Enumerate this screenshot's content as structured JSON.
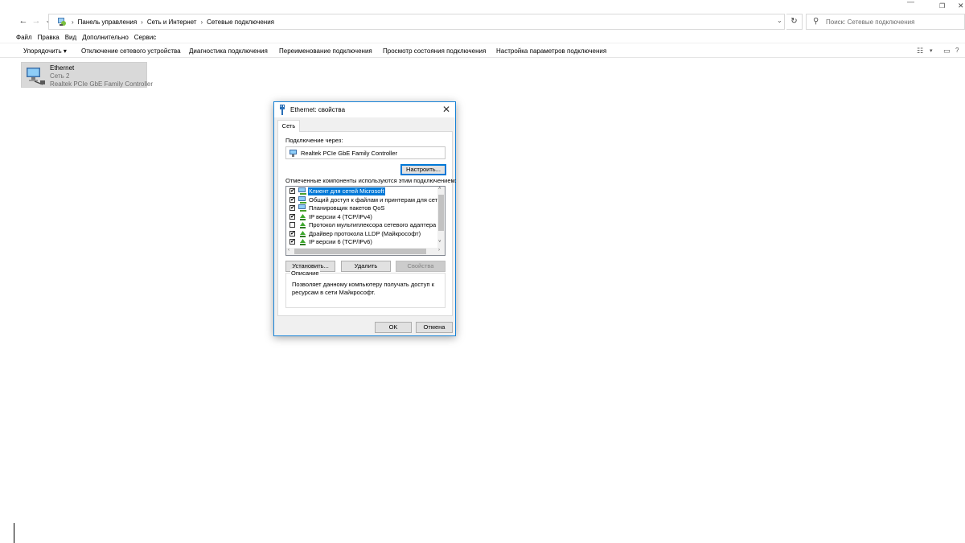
{
  "window": {
    "minimize_glyph": "—",
    "restore_glyph": "❐",
    "close_glyph": "✕"
  },
  "address_bar": {
    "back_glyph": "←",
    "forward_glyph": "→",
    "recent_glyph": "⌄",
    "up_glyph": "↑",
    "breadcrumbs": [
      "Панель управления",
      "Сеть и Интернет",
      "Сетевые подключения"
    ],
    "separator": "›",
    "dropdown_glyph": "⌄",
    "refresh_glyph": "↻"
  },
  "search": {
    "placeholder": "Поиск: Сетевые подключения",
    "icon_glyph": "⚲"
  },
  "menu": [
    "Файл",
    "Правка",
    "Вид",
    "Дополнительно",
    "Сервис"
  ],
  "command_bar": {
    "items": [
      "Упорядочить ▾",
      "Отключение сетевого устройства",
      "Диагностика подключения",
      "Переименование подключения",
      "Просмотр состояния подключения",
      "Настройка параметров подключения"
    ],
    "view_glyph": "☷",
    "view_dropdown_glyph": "▾",
    "pane_glyph": "▭"
  },
  "connection_tile": {
    "name": "Ethernet",
    "network": "Сеть 2",
    "adapter": "Realtek PCIe GbE Family Controller"
  },
  "dialog": {
    "title": "Ethernet: свойства",
    "close_glyph": "✕",
    "tab": "Сеть",
    "connect_using_label": "Подключение через:",
    "adapter_name": "Realtek PCIe GbE Family Controller",
    "configure_button": "Настроить...",
    "components_label": "Отмеченные компоненты используются этим подключением:",
    "components": [
      {
        "label": "Клиент для сетей Microsoft",
        "checked": true,
        "selected": true,
        "icon": "network-client-icon"
      },
      {
        "label": "Общий доступ к файлам и принтерам для сетей Mi",
        "checked": true,
        "selected": false,
        "icon": "file-sharing-icon"
      },
      {
        "label": "Планировщик пакетов QoS",
        "checked": true,
        "selected": false,
        "icon": "qos-icon"
      },
      {
        "label": "IP версии 4 (TCP/IPv4)",
        "checked": true,
        "selected": false,
        "icon": "protocol-icon"
      },
      {
        "label": "Протокол мультиплексора сетевого адаптера (Майк",
        "checked": false,
        "selected": false,
        "icon": "protocol-icon"
      },
      {
        "label": "Драйвер протокола LLDP (Майкрософт)",
        "checked": true,
        "selected": false,
        "icon": "protocol-icon"
      },
      {
        "label": "IP версии 6 (TCP/IPv6)",
        "checked": true,
        "selected": false,
        "icon": "protocol-icon"
      }
    ],
    "check_glyph": "✔",
    "install_button": "Установить...",
    "uninstall_button": "Удалить",
    "properties_button": "Свойства",
    "description_legend": "Описание",
    "description_text": "Позволяет данному компьютеру получать доступ к ресурсам в сети Майкрософт.",
    "ok_button": "OK",
    "cancel_button": "Отмена",
    "scroll_up_glyph": "˄",
    "scroll_down_glyph": "˅",
    "scroll_left_glyph": "‹",
    "scroll_right_glyph": "›"
  },
  "colors": {
    "accent": "#0078d7",
    "dialog_border": "#1883d7",
    "tile_selected": "#d9d9d9"
  }
}
